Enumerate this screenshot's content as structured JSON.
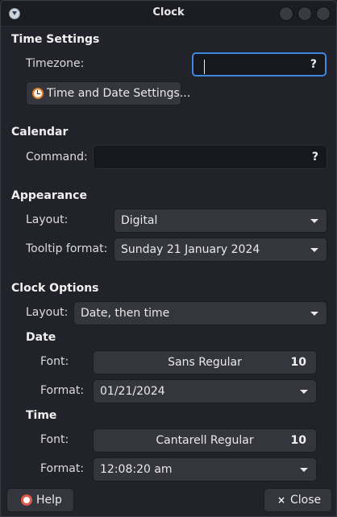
{
  "window": {
    "title": "Clock"
  },
  "time_settings": {
    "heading": "Time Settings",
    "timezone_label": "Timezone:",
    "timezone_value": "",
    "timezone_help": "?",
    "datetime_button": "Time and Date Settings..."
  },
  "calendar": {
    "heading": "Calendar",
    "command_label": "Command:",
    "command_value": "",
    "command_help": "?"
  },
  "appearance": {
    "heading": "Appearance",
    "layout_label": "Layout:",
    "layout_value": "Digital",
    "tooltip_label": "Tooltip format:",
    "tooltip_value": "Sunday 21 January 2024"
  },
  "clock_options": {
    "heading": "Clock Options",
    "layout_label": "Layout:",
    "layout_value": "Date, then time",
    "date": {
      "heading": "Date",
      "font_label": "Font:",
      "font_name": "Sans Regular",
      "font_size": "10",
      "format_label": "Format:",
      "format_value": "01/21/2024"
    },
    "time": {
      "heading": "Time",
      "font_label": "Font:",
      "font_name": "Cantarell Regular",
      "font_size": "10",
      "format_label": "Format:",
      "format_value": "12:08:20 am"
    }
  },
  "footer": {
    "help_label": "Help",
    "close_label": "Close",
    "close_glyph": "×"
  },
  "colors": {
    "accent_focus": "#3d87e0",
    "background": "#22232a",
    "control": "#34353d",
    "entry": "#17181d"
  }
}
